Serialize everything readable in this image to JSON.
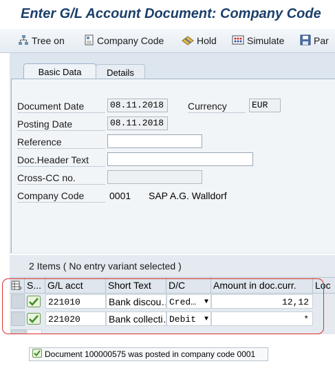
{
  "window": {
    "title": "Enter G/L Account Document: Company Code"
  },
  "toolbar": {
    "items": [
      {
        "label": "Tree on",
        "icon": "tree-icon"
      },
      {
        "label": "Company Code",
        "icon": "company-code-icon"
      },
      {
        "label": "Hold",
        "icon": "hold-icon"
      },
      {
        "label": "Simulate",
        "icon": "simulate-icon"
      },
      {
        "label": "Par",
        "icon": "save-icon"
      }
    ]
  },
  "tabs": [
    {
      "label": "Basic Data",
      "active": true
    },
    {
      "label": "Details",
      "active": false
    }
  ],
  "form": {
    "document_date": {
      "label": "Document Date",
      "value": "08.11.2018"
    },
    "currency": {
      "label": "Currency",
      "value": "EUR"
    },
    "posting_date": {
      "label": "Posting Date",
      "value": "08.11.2018"
    },
    "reference": {
      "label": "Reference",
      "value": ""
    },
    "doc_header_text": {
      "label": "Doc.Header Text",
      "value": ""
    },
    "cross_cc_no": {
      "label": "Cross-CC no.",
      "value": ""
    },
    "company_code": {
      "label": "Company Code",
      "value": "0001",
      "name": "SAP A.G. Walldorf"
    }
  },
  "grid": {
    "title": "2 Items ( No entry variant selected )",
    "columns": [
      "S...",
      "G/L acct",
      "Short Text",
      "D/C",
      "Amount in doc.curr.",
      "Loc"
    ],
    "rows": [
      {
        "status": "ok",
        "gl_acct": "221010",
        "short_text": "Bank discou…",
        "dc": "Cred…",
        "amount": "12,12"
      },
      {
        "status": "ok",
        "gl_acct": "221020",
        "short_text": "Bank collecti…",
        "dc": "Debit",
        "amount": "*"
      }
    ]
  },
  "status": {
    "message": "Document 100000575 was posted in company code 0001",
    "type": "success"
  },
  "colors": {
    "title": "#1b3f6b",
    "highlight": "#d9302a",
    "success": "#3a8f1c"
  }
}
